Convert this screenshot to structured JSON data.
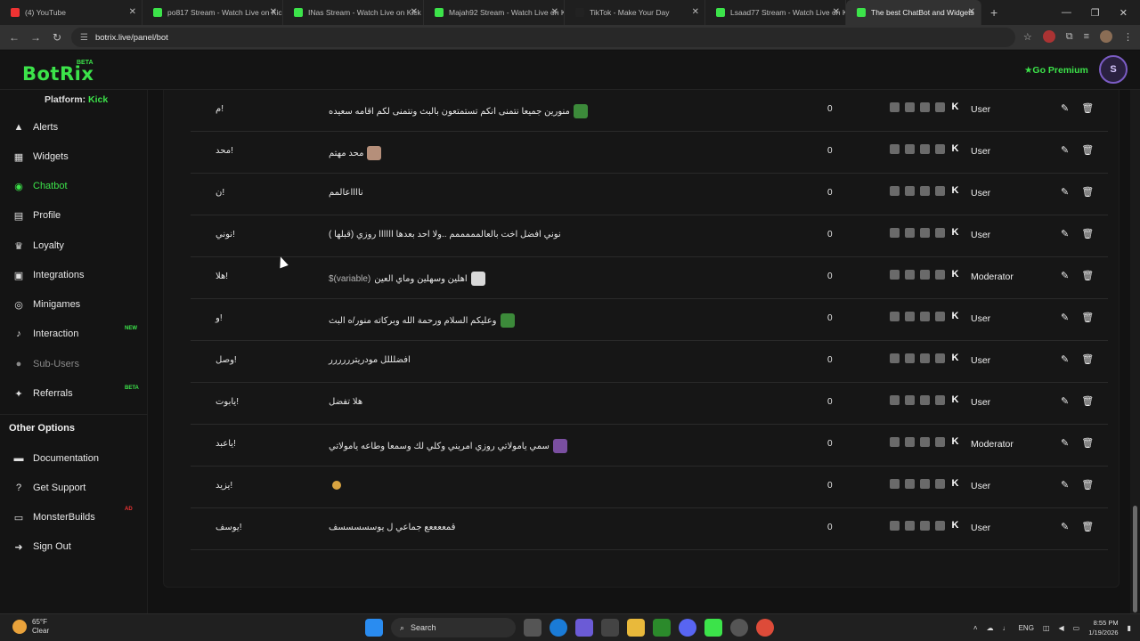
{
  "browser": {
    "tabs": [
      {
        "title": "(4) YouTube",
        "favicon_color": "#e33",
        "active": false
      },
      {
        "title": "po817 Stream - Watch Live on Kick",
        "favicon_color": "#3ce34a",
        "active": false
      },
      {
        "title": "INas Stream - Watch Live on Kick",
        "favicon_color": "#3ce34a",
        "active": false
      },
      {
        "title": "Majah92 Stream - Watch Live on Kick",
        "favicon_color": "#3ce34a",
        "active": false
      },
      {
        "title": "TikTok - Make Your Day",
        "favicon_color": "#222",
        "active": false
      },
      {
        "title": "Lsaad77 Stream - Watch Live on Kick",
        "favicon_color": "#3ce34a",
        "active": false
      },
      {
        "title": "The best ChatBot and Widgets",
        "favicon_color": "#3ce34a",
        "active": true
      }
    ],
    "url": "botrix.live/panel/bot"
  },
  "header": {
    "logo": "BotRix",
    "logo_badge": "BETA",
    "go_premium": "Go Premium"
  },
  "sidebar": {
    "platform_label": "Platform:",
    "platform_value": "Kick",
    "items": [
      {
        "label": "Alerts",
        "icon": "warning-icon",
        "glyph": "▲"
      },
      {
        "label": "Widgets",
        "icon": "grid-icon",
        "glyph": "▦"
      },
      {
        "label": "Chatbot",
        "icon": "robot-icon",
        "glyph": "◉",
        "active": true
      },
      {
        "label": "Profile",
        "icon": "id-card-icon",
        "glyph": "▤"
      },
      {
        "label": "Loyalty",
        "icon": "trophy-icon",
        "glyph": "♛"
      },
      {
        "label": "Integrations",
        "icon": "integration-icon",
        "glyph": "▣"
      },
      {
        "label": "Minigames",
        "icon": "gamepad-icon",
        "glyph": "◎"
      },
      {
        "label": "Interaction",
        "icon": "music-icon",
        "glyph": "♪",
        "badge": "NEW"
      },
      {
        "label": "Sub-Users",
        "icon": "users-icon",
        "glyph": "●",
        "muted": true
      },
      {
        "label": "Referrals",
        "icon": "referral-icon",
        "glyph": "✦",
        "badge": "BETA"
      }
    ],
    "other_title": "Other Options",
    "other_items": [
      {
        "label": "Documentation",
        "icon": "book-icon",
        "glyph": "▬"
      },
      {
        "label": "Get Support",
        "icon": "help-icon",
        "glyph": "?"
      },
      {
        "label": "MonsterBuilds",
        "icon": "monitor-icon",
        "glyph": "▭",
        "badge": "AD"
      },
      {
        "label": "Sign Out",
        "icon": "sign-out-icon",
        "glyph": "➜"
      }
    ]
  },
  "commands": [
    {
      "cmd": "م!",
      "response": "منورين جميعا نتمنى انكم تستمتعون بالبث ونتمنى لكم اقامه سعيده",
      "emote": "#3c8a3a",
      "count": "0",
      "role": "User"
    },
    {
      "cmd": "محد!",
      "response": "محد مهتم",
      "emote": "#b58f7a",
      "count": "0",
      "role": "User"
    },
    {
      "cmd": "ن!",
      "response": "نااااعالمم",
      "emote": "",
      "count": "0",
      "role": "User"
    },
    {
      "cmd": "نوني!",
      "response": "نوني افضل اخت بالعالمممممم ..ولا احد بعدها اااااا روزي (قبلها )",
      "emote": "",
      "count": "0",
      "role": "User"
    },
    {
      "cmd": "هلا!",
      "response": "اهلين وسهلين وماي العين",
      "var": "$(variable)",
      "emote": "#d9d9d9",
      "count": "0",
      "role": "Moderator"
    },
    {
      "cmd": "و!",
      "response": "وعليكم السلام ورحمة الله وبركاته منور/ه البث",
      "emote": "#3c8a3a",
      "count": "0",
      "role": "User"
    },
    {
      "cmd": "وصل!",
      "response": "افضلللل مودريترررررر",
      "emote": "",
      "count": "0",
      "role": "User"
    },
    {
      "cmd": "يابوت!",
      "response": "هلا تفضل",
      "emote": "",
      "count": "0",
      "role": "User"
    },
    {
      "cmd": "ياعبد!",
      "response": "سمي يامولاتي روزي امريني وكلي لك وسمعا وطاعه يامولاتي",
      "emote": "#7a4fa0",
      "count": "0",
      "role": "Moderator"
    },
    {
      "cmd": "يزيد!",
      "response": "",
      "emote": "#d9a441",
      "count": "0",
      "role": "User"
    },
    {
      "cmd": "يوسف!",
      "response": "قمععععع جماعي ل يوسسسسسف",
      "emote": "",
      "count": "0",
      "role": "User"
    }
  ],
  "taskbar": {
    "temp": "65°F",
    "condition": "Clear",
    "search": "Search",
    "lang": "ENG",
    "time": "8:55 PM",
    "date": "1/19/2026"
  }
}
